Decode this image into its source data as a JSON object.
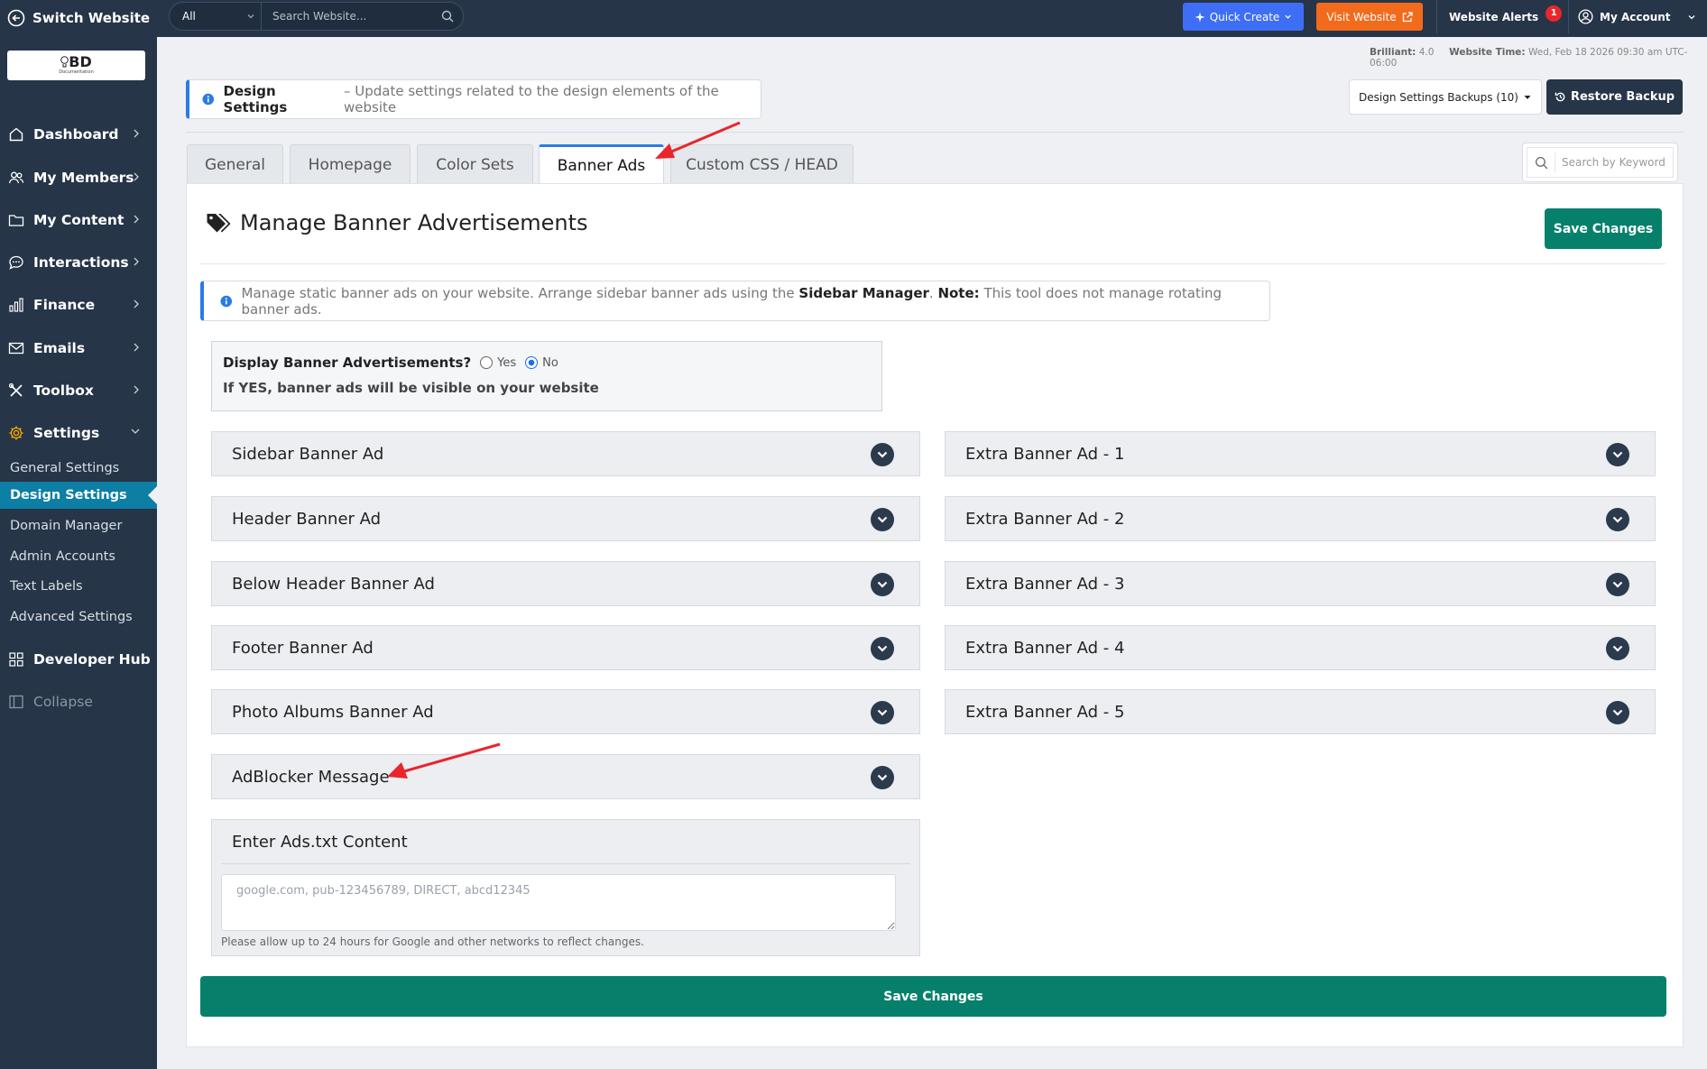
{
  "topbar": {
    "switch_label": "Switch Website",
    "search_scope": "All",
    "search_placeholder": "Search Website...",
    "quick_create": "Quick Create",
    "visit_website": "Visit Website",
    "alerts_label": "Website Alerts",
    "alerts_count": "1",
    "account_label": "My Account"
  },
  "logo": {
    "text": "BD",
    "subtext": "Documentation"
  },
  "sidebar": {
    "items": [
      {
        "label": "Dashboard",
        "icon": "home-icon"
      },
      {
        "label": "My Members",
        "icon": "users-icon"
      },
      {
        "label": "My Content",
        "icon": "folder-icon"
      },
      {
        "label": "Interactions",
        "icon": "chat-icon"
      },
      {
        "label": "Finance",
        "icon": "bar-chart-icon"
      },
      {
        "label": "Emails",
        "icon": "envelope-icon"
      },
      {
        "label": "Toolbox",
        "icon": "tools-icon"
      },
      {
        "label": "Settings",
        "icon": "gear-icon"
      }
    ],
    "settings_sub": [
      {
        "label": "General Settings"
      },
      {
        "label": "Design Settings",
        "active": true
      },
      {
        "label": "Domain Manager"
      },
      {
        "label": "Admin Accounts"
      },
      {
        "label": "Text Labels"
      },
      {
        "label": "Advanced Settings"
      }
    ],
    "developer_hub": "Developer Hub",
    "collapse": "Collapse"
  },
  "meta": {
    "plan_label": "Brilliant:",
    "plan_value": "4.0",
    "time_label": "Website Time:",
    "time_value": "Wed, Feb 18 2026 09:30 am UTC-06:00"
  },
  "header": {
    "title": "Design Settings",
    "description": "– Update settings related to the design elements of the website",
    "backups_label": "Design Settings Backups (10)",
    "restore_label": "Restore Backup"
  },
  "tabs": [
    {
      "label": "General"
    },
    {
      "label": "Homepage"
    },
    {
      "label": "Color Sets"
    },
    {
      "label": "Banner Ads",
      "active": true
    },
    {
      "label": "Custom CSS / HEAD"
    }
  ],
  "keyword_placeholder": "Search by Keyword",
  "main": {
    "heading": "Manage Banner Advertisements",
    "save_label": "Save Changes",
    "note_pre": "Manage static banner ads on your website. Arrange sidebar banner ads using the",
    "note_link": "Sidebar Manager",
    "note_label": "Note:",
    "note_post": "This tool does not manage rotating banner ads.",
    "display_question": "Display Banner Advertisements?",
    "yes_label": "Yes",
    "no_label": "No",
    "display_hint": "If YES, banner ads will be visible on your website",
    "left_accordions": [
      "Sidebar Banner Ad",
      "Header Banner Ad",
      "Below Header Banner Ad",
      "Footer Banner Ad",
      "Photo Albums Banner Ad",
      "AdBlocker Message"
    ],
    "right_accordions": [
      "Extra Banner Ad - 1",
      "Extra Banner Ad - 2",
      "Extra Banner Ad - 3",
      "Extra Banner Ad - 4",
      "Extra Banner Ad - 5"
    ],
    "ads_title": "Enter Ads.txt Content",
    "ads_placeholder": "google.com, pub-123456789, DIRECT, abcd12345",
    "ads_hint": "Please allow up to 24 hours for Google and other networks to reflect changes.",
    "save_bottom_label": "Save Changes"
  },
  "colors": {
    "navy": "#263548",
    "accent_blue": "#2c7be5",
    "green": "#06806b",
    "orange": "#f26b1d",
    "quick_blue": "#3d6ef5",
    "annotation_red": "#e8262c"
  }
}
